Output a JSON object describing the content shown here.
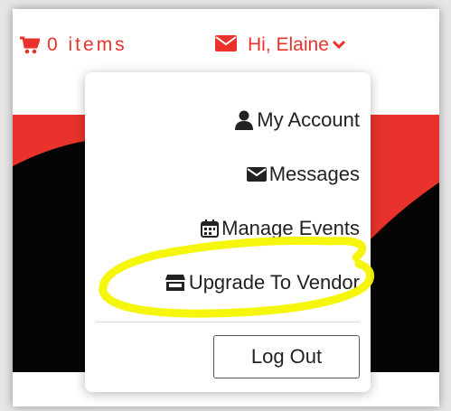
{
  "colors": {
    "accent": "#e8322b",
    "hero_black": "#050505",
    "highlight": "#ffff00"
  },
  "header": {
    "cart": {
      "icon": "cart-icon",
      "label": "0 items"
    },
    "user": {
      "icon": "envelope-icon",
      "greeting": "Hi, Elaine",
      "chevron": "chevron-down-icon"
    }
  },
  "dropdown": {
    "items": [
      {
        "icon": "user-icon",
        "label": "My Account"
      },
      {
        "icon": "envelope-icon",
        "label": "Messages"
      },
      {
        "icon": "calendar-icon",
        "label": "Manage Events"
      },
      {
        "icon": "store-icon",
        "label": "Upgrade To Vendor",
        "annotated": true
      }
    ],
    "logout_label": "Log Out"
  },
  "annotation": {
    "type": "freehand-circle",
    "color": "yellow",
    "target": "Upgrade To Vendor"
  }
}
